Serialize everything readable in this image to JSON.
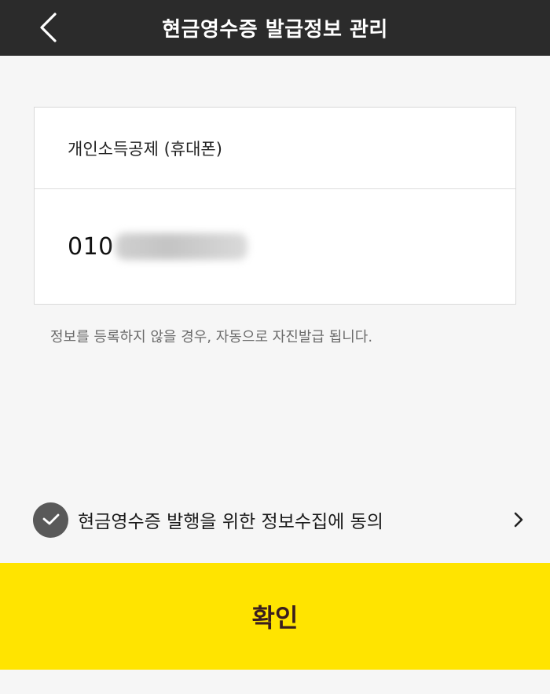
{
  "header": {
    "title": "현금영수증 발급정보 관리",
    "back_icon": "chevron-left-icon"
  },
  "form": {
    "receipt_type": "개인소득공제 (휴대폰)",
    "phone_prefix": "010"
  },
  "notice": "정보를 등록하지 않을 경우, 자동으로 자진발급 됩니다.",
  "agreement": {
    "label": "현금영수증 발행을 위한 정보수집에 동의",
    "checked": true,
    "check_icon": "check-circle-icon",
    "arrow_icon": "chevron-right-icon"
  },
  "confirm_button": {
    "label": "확인"
  },
  "colors": {
    "header_bg": "#2b2b2b",
    "background": "#f6f6f6",
    "accent_yellow": "#ffe400",
    "button_text": "#3a1e1e",
    "check_bg": "#595959"
  }
}
